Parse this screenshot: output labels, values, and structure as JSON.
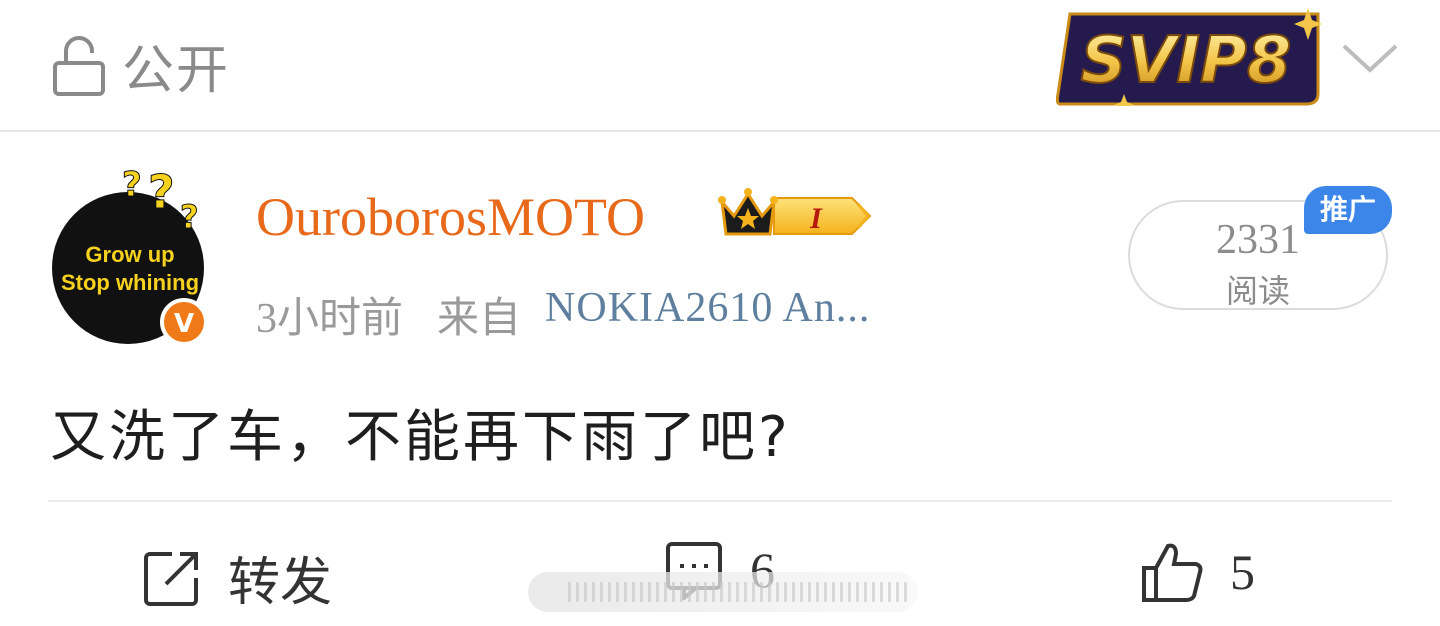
{
  "topbar": {
    "privacy_label": "公开",
    "vip_badge_text": "SVIP8"
  },
  "post": {
    "author": {
      "name": "OuroborosMOTO",
      "avatar_text_line1": "Grow up",
      "avatar_text_line2": "Stop whining",
      "verified_mark": "V",
      "level_badge": "I"
    },
    "time": "3小时前",
    "from_label": "来自",
    "device": "NOKIA2610 An...",
    "read_count": "2331",
    "read_label": "阅读",
    "promo_tag": "推广",
    "text": "又洗了车，不能再下雨了吧?"
  },
  "actions": {
    "repost_label": "转发",
    "comment_count": "6",
    "like_count": "5"
  },
  "colors": {
    "username": "#e8691a",
    "device_link": "#5f7f9f",
    "promo_blue": "#3b86e8",
    "muted_gray": "#9a9a9a"
  },
  "icons": [
    "unlock-icon",
    "chevron-down-icon",
    "crown-icon",
    "repost-icon",
    "comment-icon",
    "like-icon"
  ]
}
